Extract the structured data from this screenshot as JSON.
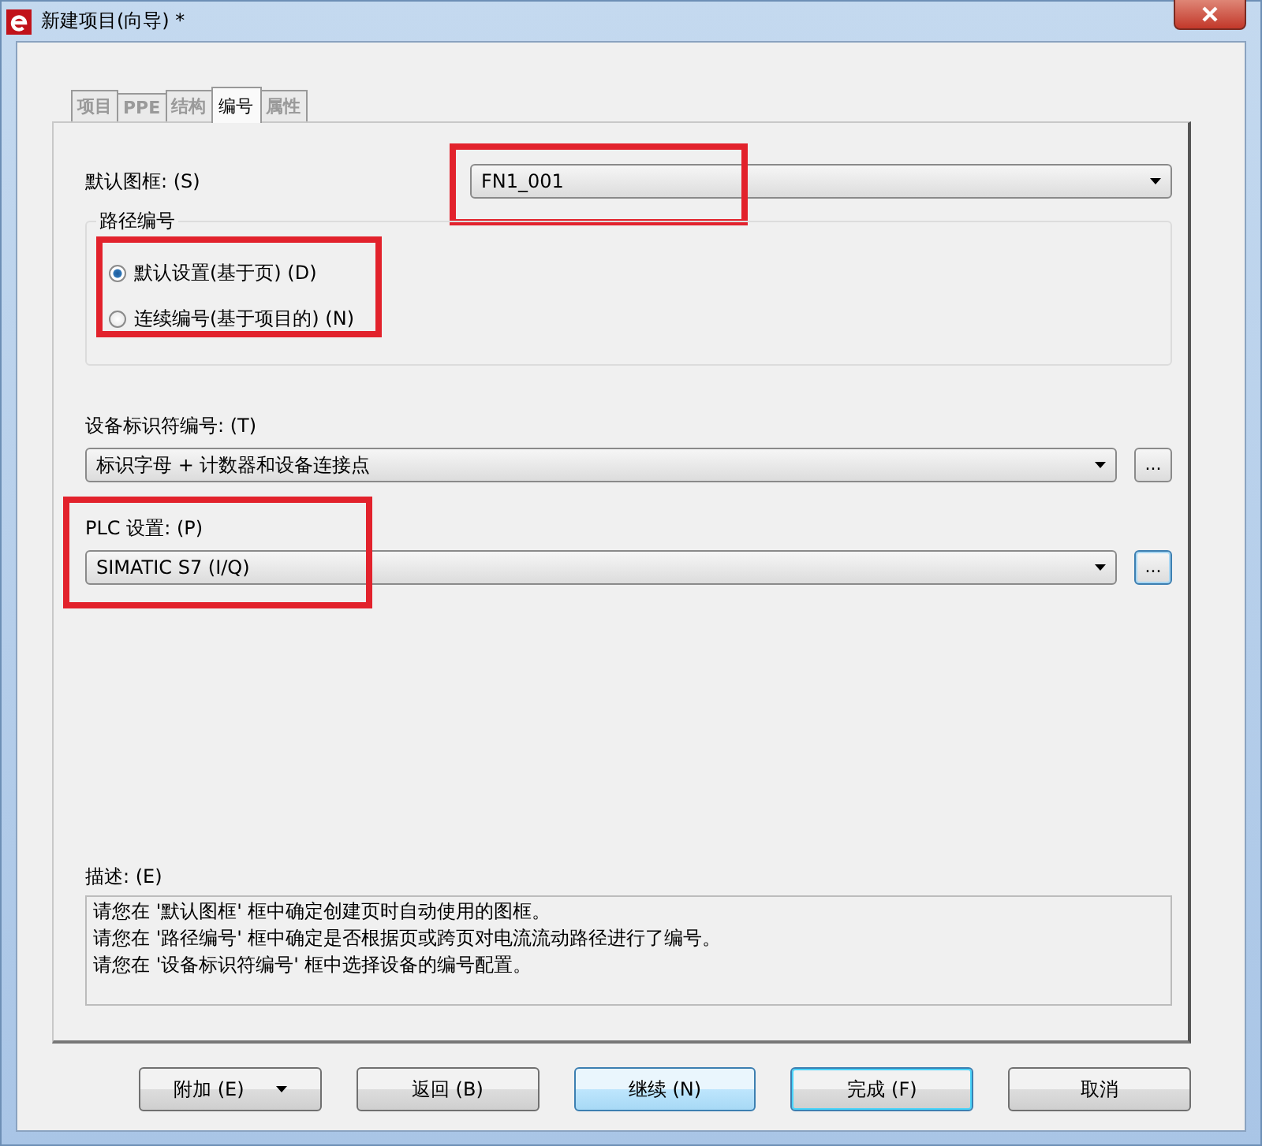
{
  "window": {
    "title": "新建项目(向导) *"
  },
  "tabs": [
    {
      "label": "项目",
      "selected": false,
      "disabled": true
    },
    {
      "label": "PPE",
      "selected": false,
      "disabled": true
    },
    {
      "label": "结构",
      "selected": false,
      "disabled": true
    },
    {
      "label": "编号",
      "selected": true,
      "disabled": false
    },
    {
      "label": "属性",
      "selected": false,
      "disabled": true
    }
  ],
  "default_frame": {
    "label": "默认图框: (S)",
    "value": "FN1_001",
    "highlighted": true
  },
  "route_numbering": {
    "title": "路径编号",
    "highlighted": true,
    "options": [
      {
        "label": "默认设置(基于页) (D)",
        "selected": true
      },
      {
        "label": "连续编号(基于项目的) (N)",
        "selected": false
      }
    ]
  },
  "device_tag_numbering": {
    "label": "设备标识符编号: (T)",
    "value": "标识字母 + 计数器和设备连接点",
    "more_button": "...",
    "highlighted": false,
    "focused": false
  },
  "plc_settings": {
    "label": "PLC 设置: (P)",
    "value": "SIMATIC S7 (I/Q)",
    "more_button": "...",
    "highlighted": true,
    "focused": true
  },
  "description": {
    "label": "描述: (E)",
    "lines": [
      "请您在 '默认图框' 框中确定创建页时自动使用的图框。",
      "请您在 '路径编号' 框中确定是否根据页或跨页对电流流动路径进行了编号。",
      "请您在 '设备标识符编号' 框中选择设备的编号配置。"
    ]
  },
  "buttons": [
    {
      "label": "附加 (E)",
      "menu": true,
      "hovered": false,
      "default": false
    },
    {
      "label": "返回 (B)",
      "menu": false,
      "hovered": false,
      "default": false
    },
    {
      "label": "继续 (N)",
      "menu": false,
      "hovered": true,
      "default": false
    },
    {
      "label": "完成 (F)",
      "menu": false,
      "hovered": false,
      "default": true
    },
    {
      "label": "取消",
      "menu": false,
      "hovered": false,
      "default": false
    }
  ]
}
